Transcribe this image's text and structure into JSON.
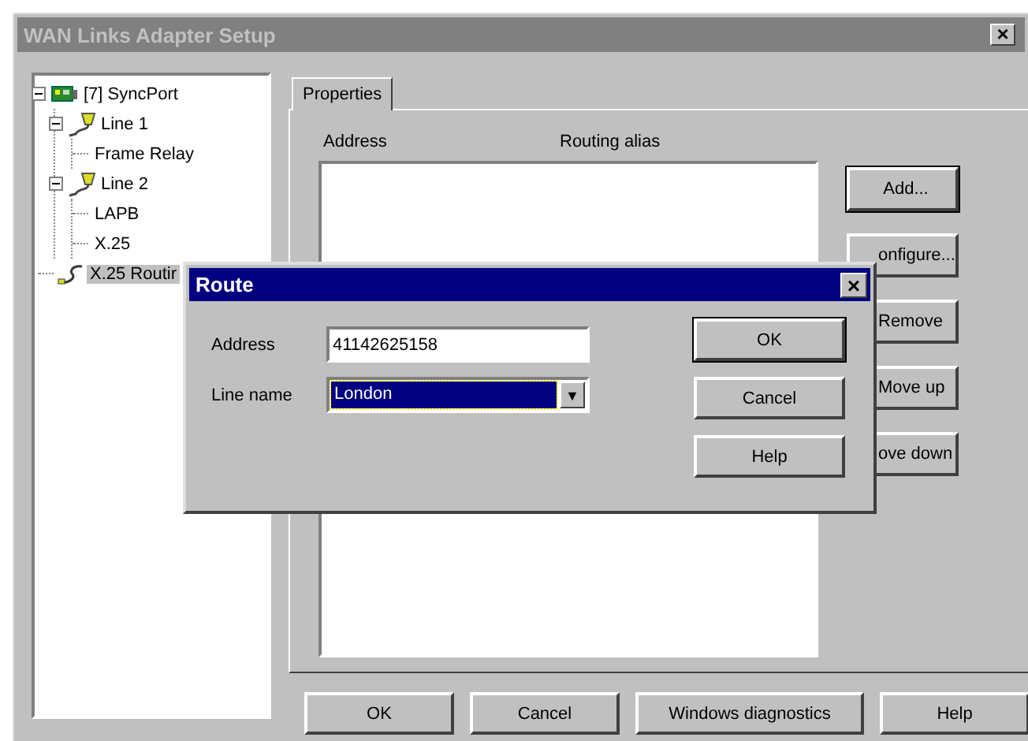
{
  "window": {
    "title": "WAN Links Adapter Setup",
    "close": "×"
  },
  "tree": [
    {
      "label": "[7] SyncPort",
      "kind": "port",
      "selected": false,
      "expanded": true,
      "children": [
        {
          "label": "Line 1",
          "kind": "line",
          "selected": false,
          "expanded": true,
          "children": [
            {
              "label": "Frame Relay",
              "selected": false
            }
          ]
        },
        {
          "label": "Line 2",
          "kind": "line",
          "selected": false,
          "expanded": true,
          "children": [
            {
              "label": "LAPB",
              "selected": false
            },
            {
              "label": "X.25",
              "selected": false
            }
          ]
        }
      ]
    },
    {
      "label": "X.25 Routir",
      "kind": "routing",
      "selected": true
    }
  ],
  "tabs": [
    {
      "label": "Properties",
      "selected": true
    }
  ],
  "table": {
    "columns": [
      "Address",
      "Routing alias"
    ]
  },
  "side_buttons": [
    "Add...",
    "onfigure...",
    "Remove",
    "Move up",
    "ove down"
  ],
  "buttons": [
    "OK",
    "Cancel",
    "Windows diagnostics",
    "Help"
  ],
  "dialog": {
    "title": "Route",
    "close": "×",
    "fields": [
      {
        "label": "Address",
        "kind": "text",
        "value": "41142625158"
      },
      {
        "label": "Line name",
        "kind": "combo",
        "value": "London",
        "arrow": "▼"
      }
    ],
    "buttons": [
      "OK",
      "Cancel",
      "Help"
    ]
  }
}
